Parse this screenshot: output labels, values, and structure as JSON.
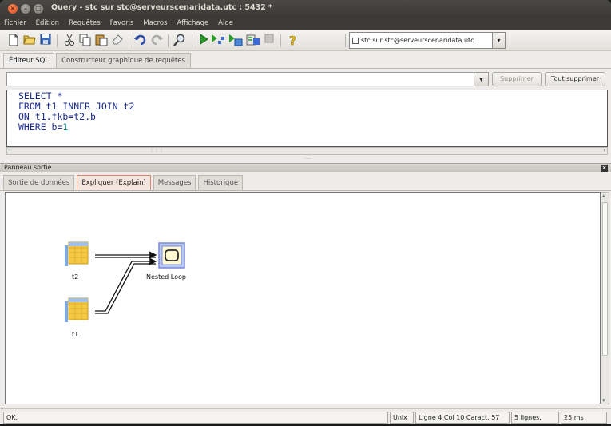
{
  "window": {
    "title": "Query - stc sur stc@serveurscenaridata.utc : 5432 *"
  },
  "menu": [
    "Fichier",
    "Édition",
    "Requêtes",
    "Favoris",
    "Macros",
    "Affichage",
    "Aide"
  ],
  "toolbar": {
    "icons": [
      "new-file-icon",
      "open-folder-icon",
      "save-icon",
      "cut-icon",
      "copy-icon",
      "paste-icon",
      "clear-icon",
      "undo-icon",
      "redo-icon",
      "find-icon",
      "execute-icon",
      "explain-icon",
      "explain-analyze-icon",
      "execute-to-file-icon",
      "cancel-query-icon",
      "help-icon"
    ],
    "connection": "stc sur stc@serveurscenaridata.utc"
  },
  "editor_tabs": [
    "Éditeur SQL",
    "Constructeur graphique de requêtes"
  ],
  "history": {
    "value": "",
    "delete_label": "Supprimer",
    "delete_all_label": "Tout supprimer"
  },
  "sql": {
    "line1": "SELECT *",
    "line2": "FROM t1 INNER JOIN t2",
    "line3": "ON t1.fkb=t2.b",
    "line4_kw": "WHERE b=",
    "line4_num": "1"
  },
  "output_panel": {
    "title": "Panneau sortie",
    "tabs": [
      "Sortie de données",
      "Expliquer (Explain)",
      "Messages",
      "Historique"
    ],
    "active_tab": "Expliquer (Explain)"
  },
  "explain": {
    "nodes": [
      {
        "label": "t2",
        "kind": "table-scan"
      },
      {
        "label": "t1",
        "kind": "table-scan"
      },
      {
        "label": "Nested Loop",
        "kind": "join"
      }
    ]
  },
  "status": {
    "message": "OK.",
    "line_endings": "Unix",
    "position": "Ligne 4 Col 10 Caract. 57",
    "rows": "5 lignes.",
    "time": "25 ms"
  }
}
